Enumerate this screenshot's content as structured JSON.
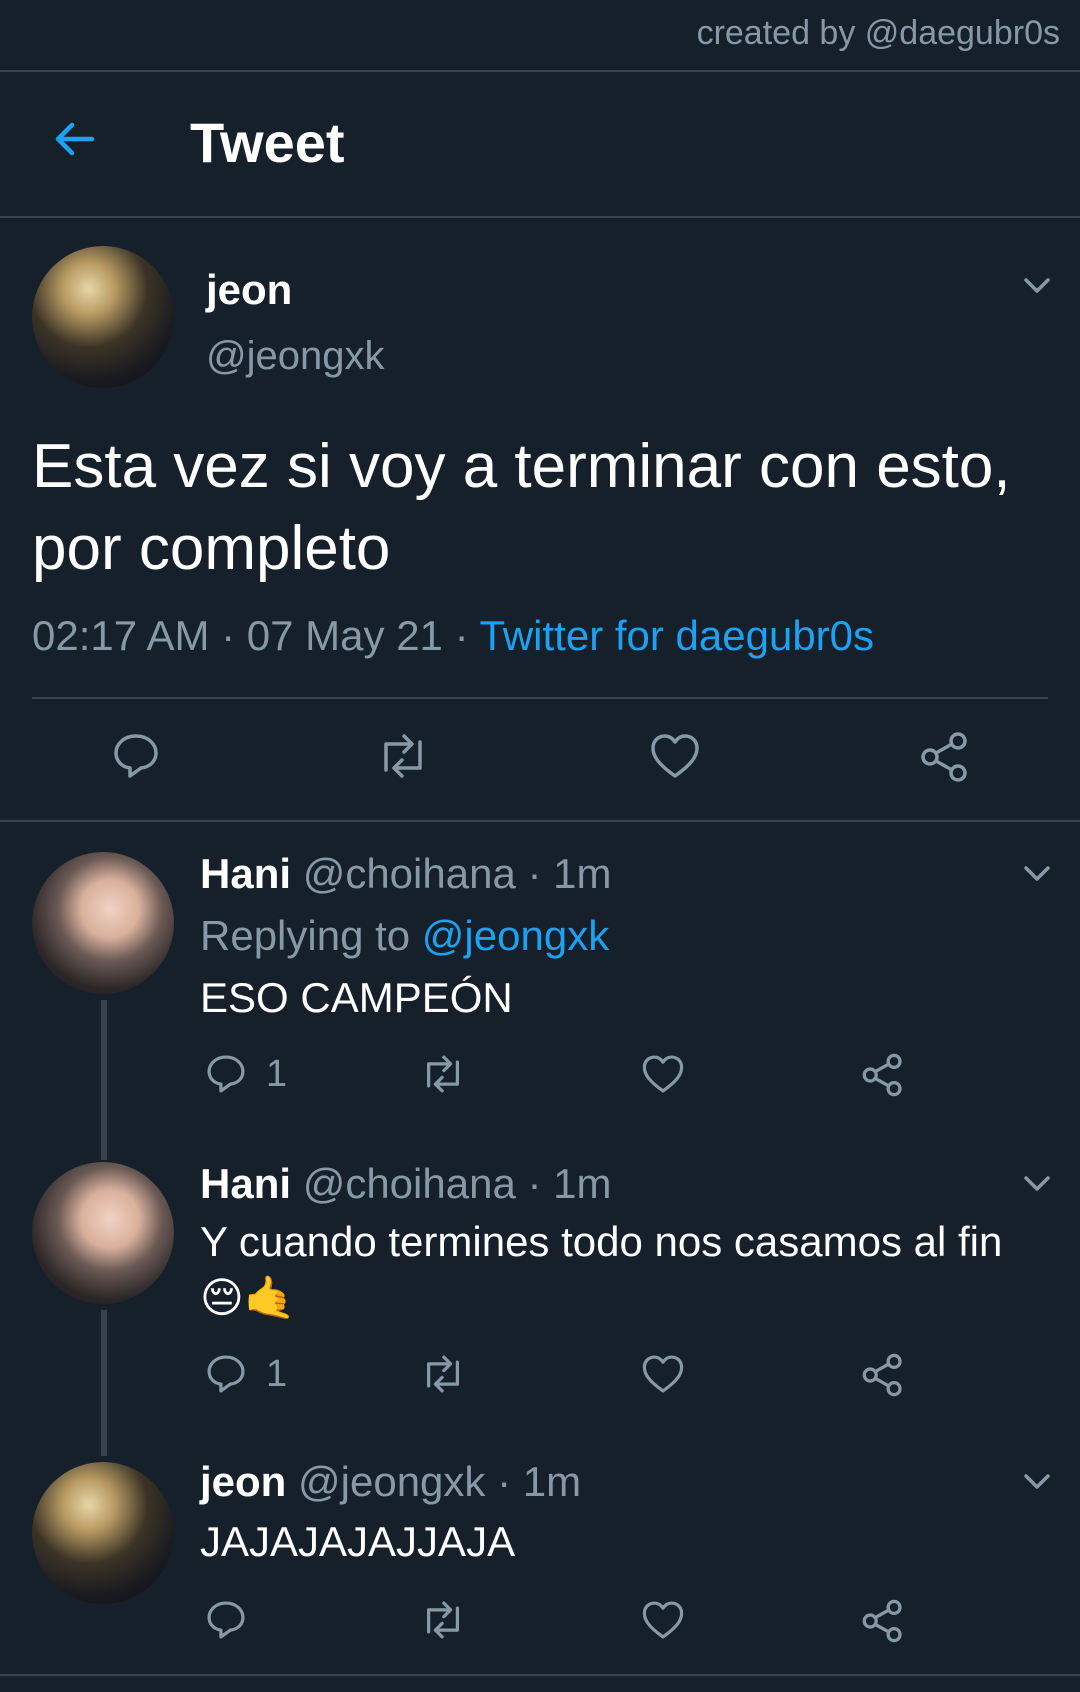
{
  "credit": "created by @daegubr0s",
  "header": {
    "title": "Tweet"
  },
  "tweet": {
    "name": "jeon",
    "handle": "@jeongxk",
    "text": "Esta vez si voy a terminar con esto, por completo",
    "time": "02:17 AM",
    "date": "07 May 21",
    "source": "Twitter for daegubr0s"
  },
  "replies": [
    {
      "name": "Hani",
      "handle": "@choihana",
      "time": "1m",
      "replying_prefix": "Replying to",
      "replying_to": "@jeongxk",
      "text": "ESO CAMPEÓN",
      "reply_count": "1"
    },
    {
      "name": "Hani",
      "handle": "@choihana",
      "time": "1m",
      "text": "Y cuando termines todo nos casamos  al fin",
      "emoji": "😔🤙",
      "reply_count": "1"
    },
    {
      "name": "jeon",
      "handle": "@jeongxk",
      "time": "1m",
      "text": "JAJAJAJAJJAJA"
    }
  ],
  "icons": {
    "back": "arrow-left-icon",
    "chevron": "chevron-down-icon",
    "reply": "reply-icon",
    "retweet": "retweet-icon",
    "like": "heart-icon",
    "share": "share-icon"
  },
  "colors": {
    "background": "#15202b",
    "accent": "#1da1f2",
    "muted": "#8899a6",
    "divider": "#38444d"
  }
}
